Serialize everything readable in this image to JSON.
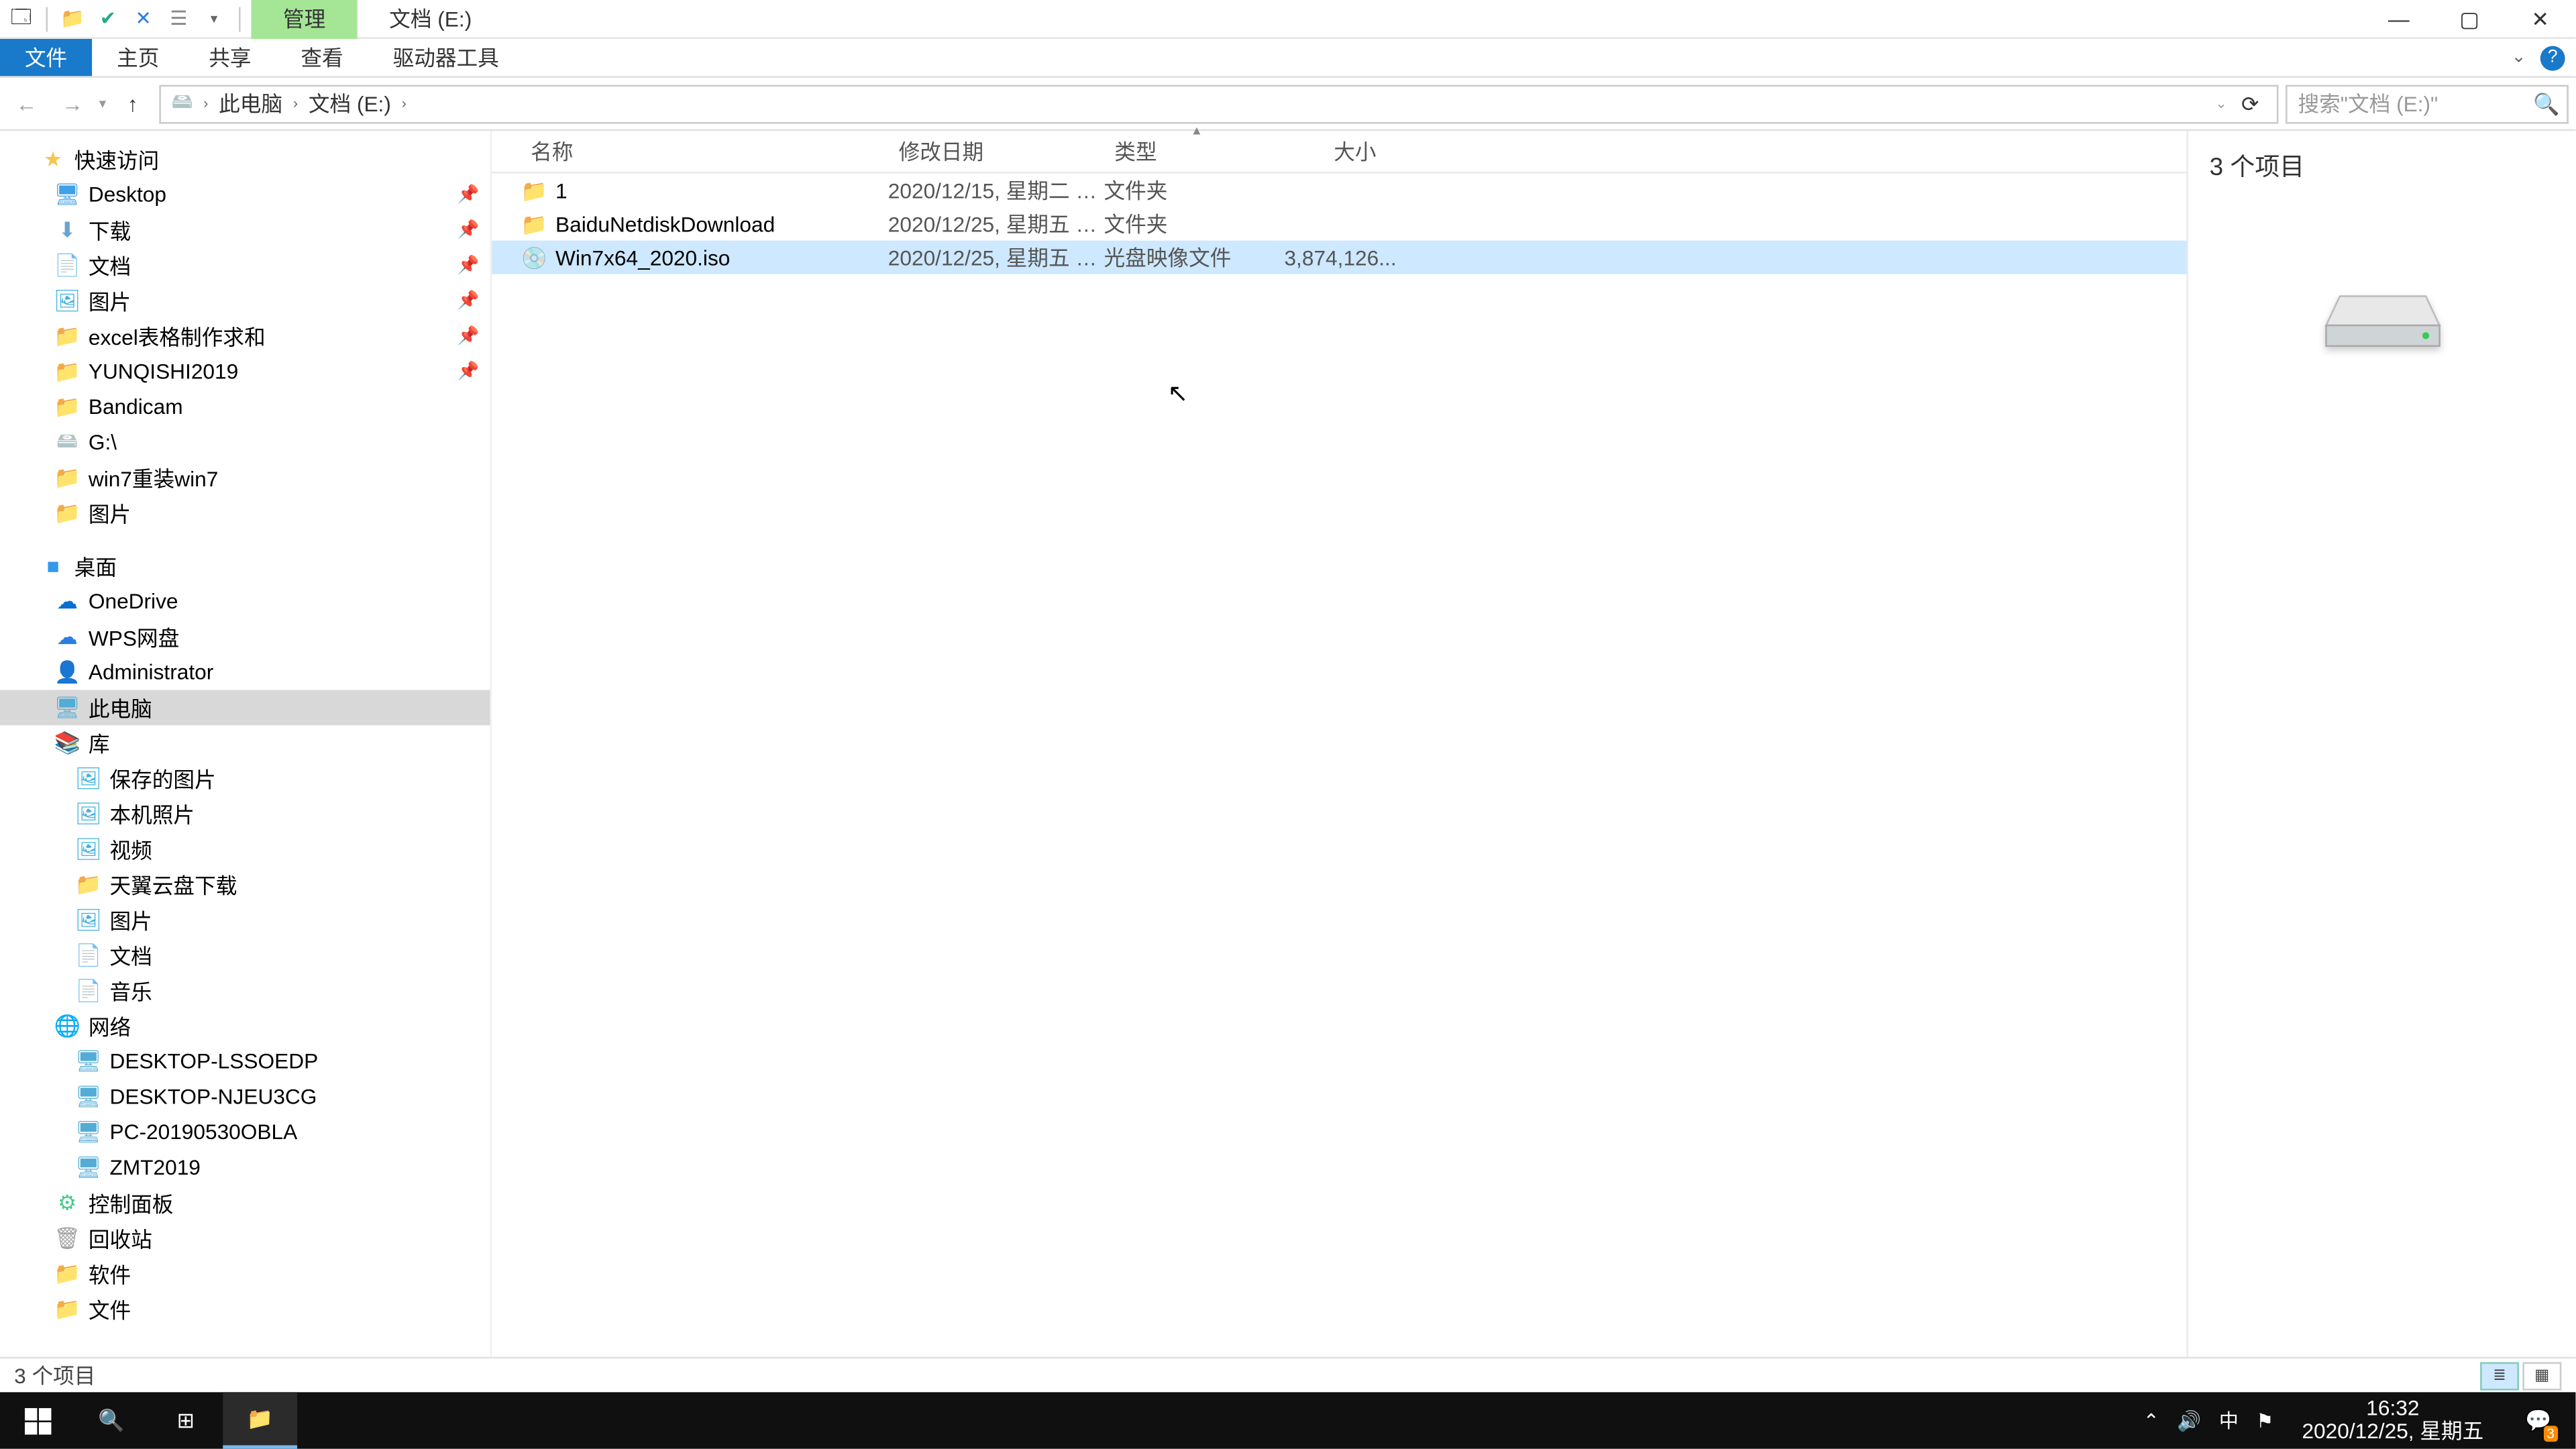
{
  "titlebar": {
    "context_tab": "管理",
    "location": "文档 (E:)",
    "qat_icons": [
      "app",
      "folder",
      "check",
      "close",
      "props",
      "dropdown"
    ]
  },
  "ribbon": {
    "file": "文件",
    "tabs": [
      "主页",
      "共享",
      "查看",
      "驱动器工具"
    ]
  },
  "addressbar": {
    "back_enabled": false,
    "forward_enabled": false,
    "crumbs": [
      "此电脑",
      "文档 (E:)"
    ],
    "search_placeholder": "搜索\"文档 (E:)\""
  },
  "tree": {
    "quick_access": {
      "label": "快速访问",
      "items": [
        {
          "label": "Desktop",
          "icon": "desk",
          "pinned": true
        },
        {
          "label": "下载",
          "icon": "down",
          "pinned": true
        },
        {
          "label": "文档",
          "icon": "doc",
          "pinned": true
        },
        {
          "label": "图片",
          "icon": "pic",
          "pinned": true
        },
        {
          "label": "excel表格制作求和",
          "icon": "folder",
          "pinned": true
        },
        {
          "label": "YUNQISHI2019",
          "icon": "folder",
          "pinned": true
        },
        {
          "label": "Bandicam",
          "icon": "folder",
          "pinned": false
        },
        {
          "label": "G:\\",
          "icon": "drive",
          "pinned": false
        },
        {
          "label": "win7重装win7",
          "icon": "folder",
          "pinned": false
        },
        {
          "label": "图片",
          "icon": "folder",
          "pinned": false
        }
      ]
    },
    "desktop": {
      "label": "桌面",
      "items": [
        {
          "label": "OneDrive",
          "icon": "cloud"
        },
        {
          "label": "WPS网盘",
          "icon": "wps"
        },
        {
          "label": "Administrator",
          "icon": "user"
        },
        {
          "label": "此电脑",
          "icon": "pc",
          "selected": true
        },
        {
          "label": "库",
          "icon": "lib"
        },
        {
          "label": "保存的图片",
          "icon": "pic",
          "lvl": 2
        },
        {
          "label": "本机照片",
          "icon": "pic",
          "lvl": 2
        },
        {
          "label": "视频",
          "icon": "pic",
          "lvl": 2
        },
        {
          "label": "天翼云盘下载",
          "icon": "folder",
          "lvl": 2
        },
        {
          "label": "图片",
          "icon": "pic",
          "lvl": 2
        },
        {
          "label": "文档",
          "icon": "doc",
          "lvl": 2
        },
        {
          "label": "音乐",
          "icon": "doc",
          "lvl": 2
        },
        {
          "label": "网络",
          "icon": "net"
        },
        {
          "label": "DESKTOP-LSSOEDP",
          "icon": "pc",
          "lvl": 2
        },
        {
          "label": "DESKTOP-NJEU3CG",
          "icon": "pc",
          "lvl": 2
        },
        {
          "label": "PC-20190530OBLA",
          "icon": "pc",
          "lvl": 2
        },
        {
          "label": "ZMT2019",
          "icon": "pc",
          "lvl": 2
        },
        {
          "label": "控制面板",
          "icon": "cp"
        },
        {
          "label": "回收站",
          "icon": "rec"
        },
        {
          "label": "软件",
          "icon": "folder"
        },
        {
          "label": "文件",
          "icon": "folder"
        }
      ]
    }
  },
  "columns": {
    "name": "名称",
    "date": "修改日期",
    "type": "类型",
    "size": "大小"
  },
  "files": [
    {
      "name": "1",
      "date": "2020/12/15, 星期二 1...",
      "type": "文件夹",
      "size": "",
      "icon": "folder"
    },
    {
      "name": "BaiduNetdiskDownload",
      "date": "2020/12/25, 星期五 1...",
      "type": "文件夹",
      "size": "",
      "icon": "folder"
    },
    {
      "name": "Win7x64_2020.iso",
      "date": "2020/12/25, 星期五 1...",
      "type": "光盘映像文件",
      "size": "3,874,126...",
      "icon": "disc",
      "selected": true
    }
  ],
  "preview": {
    "count_text": "3 个项目"
  },
  "statusbar": {
    "text": "3 个项目"
  },
  "taskbar": {
    "buttons": [
      "start",
      "search",
      "taskview",
      "explorer"
    ],
    "tray": {
      "ime": "中",
      "time": "16:32",
      "date": "2020/12/25, 星期五",
      "notif_count": "3"
    }
  }
}
